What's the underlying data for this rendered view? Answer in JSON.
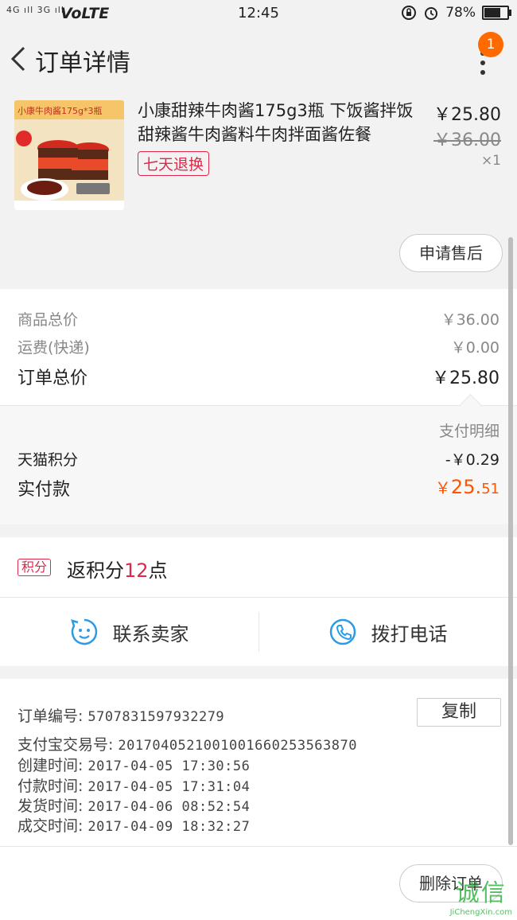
{
  "status_bar": {
    "signal": "4G ıll 3G ıll",
    "network": "VoLTE",
    "time": "12:45",
    "battery_percent": "78%",
    "battery_level": 0.78
  },
  "header": {
    "title": "订单详情",
    "notification_count": "1"
  },
  "product": {
    "image_caption": "小康牛肉酱175g*3瓶",
    "title": "小康甜辣牛肉酱175g3瓶 下饭酱拌饭甜辣酱牛肉酱料牛肉拌面酱佐餐",
    "tag": "七天退换",
    "price": "￥25.80",
    "original_price": "￥36.00",
    "quantity": "×1",
    "after_sale_label": "申请售后"
  },
  "summary": {
    "goods_total_label": "商品总价",
    "goods_total_value": "￥36.00",
    "shipping_label": "运费(快递)",
    "shipping_value": "￥0.00",
    "order_total_label": "订单总价",
    "order_total_value": "￥25.80",
    "payment_detail_label": "支付明细",
    "points_label": "天猫积分",
    "points_value": "-￥0.29",
    "paid_label": "实付款",
    "paid_currency": "￥",
    "paid_int": "25.",
    "paid_dec": "51"
  },
  "points": {
    "tag": "积分",
    "prefix": "返积分",
    "amount": "12",
    "suffix": "点"
  },
  "contact": {
    "seller_label": "联系卖家",
    "phone_label": "拨打电话"
  },
  "order_info": {
    "order_no_label": "订单编号:",
    "order_no": "5707831597932279",
    "copy_label": "复制",
    "alipay_label": "支付宝交易号:",
    "alipay_no": "2017040521001001660253563870",
    "created_label": "创建时间:",
    "created": "2017-04-05 17:30:56",
    "paid_label": "付款时间:",
    "paid": "2017-04-05 17:31:04",
    "shipped_label": "发货时间:",
    "shipped": "2017-04-06 08:52:54",
    "completed_label": "成交时间:",
    "completed": "2017-04-09 18:32:27"
  },
  "bottom": {
    "delete_label": "删除订单"
  },
  "watermark": {
    "text": "诚信",
    "url": "JiChengXin.com"
  },
  "colors": {
    "accent_orange": "#ff5500",
    "tag_red": "#e0294a",
    "icon_blue": "#2b9be6",
    "badge_orange": "#ff6a00"
  }
}
